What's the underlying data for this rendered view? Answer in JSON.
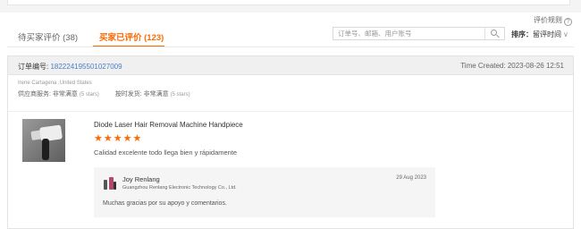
{
  "header": {
    "rules_link": "评价规则",
    "help_icon": "?"
  },
  "tabs": [
    {
      "label": "待买家评价 (38)",
      "active": false
    },
    {
      "label": "买家已评价 (123)",
      "active": true
    }
  ],
  "search": {
    "placeholder": "订单号、邮箱、用户账号",
    "icon": "search-icon"
  },
  "sort": {
    "label": "排序：",
    "value": "留评时间",
    "chevron": "∨"
  },
  "order": {
    "number_label": "订单编号: ",
    "number": "182224195501027009",
    "time_created": "Time Created: 2023-08-26 12:51",
    "buyer_location": "Irene Cartagena ,United States",
    "rating1_label": "供应商服务: 非常满意",
    "rating1_detail": "(5 stars)",
    "rating2_label": "按时发货: 非常满意",
    "rating2_detail": "(5 stars)"
  },
  "product": {
    "name": "Diode Laser Hair Removal Machine Handpiece",
    "stars": "★★★★★",
    "rating": 5,
    "review": "Calidad excelente todo llega bien y rápidamente"
  },
  "reply": {
    "name": "Joy Renlang",
    "company": "Guangzhou Renlang Electronic Technology Co., Ltd.",
    "date": "29 Aug 2023",
    "text": "Muchas gracias por su apoyo y comentarios."
  },
  "colors": {
    "accent": "#ff6a00",
    "link": "#4a7fc7"
  }
}
